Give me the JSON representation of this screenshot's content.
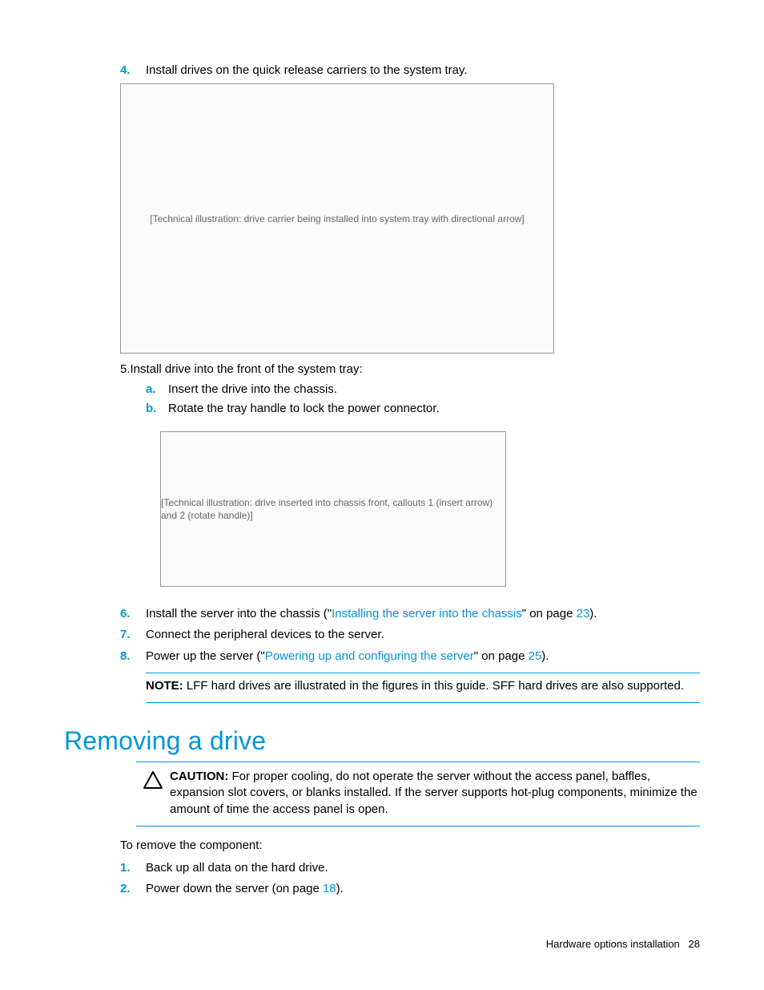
{
  "steps": {
    "s4": {
      "num": "4.",
      "text": "Install drives on the quick release carriers to the system tray."
    },
    "s5": {
      "num": "5.",
      "text": "Install drive into the front of the system tray:",
      "sub": {
        "a": {
          "num": "a.",
          "text": "Insert the drive into the chassis."
        },
        "b": {
          "num": "b.",
          "text": "Rotate the tray handle to lock the power connector."
        }
      }
    },
    "s6": {
      "num": "6.",
      "pre": "Install the server into the chassis (\"",
      "link": "Installing the server into the chassis",
      "mid": "\" on page ",
      "page": "23",
      "post": ")."
    },
    "s7": {
      "num": "7.",
      "text": "Connect the peripheral devices to the server."
    },
    "s8": {
      "num": "8.",
      "pre": "Power up the server (\"",
      "link": "Powering up and configuring the server",
      "mid": "\" on page ",
      "page": "25",
      "post": ")."
    }
  },
  "note": {
    "label": "NOTE:",
    "text": "  LFF hard drives are illustrated in the figures in this guide. SFF hard drives are also supported."
  },
  "heading": "Removing a drive",
  "caution": {
    "label": "CAUTION:",
    "text": "   For proper cooling, do not operate the server without the access panel, baffles, expansion slot covers, or blanks installed. If the server supports hot-plug components, minimize the amount of time the access panel is open."
  },
  "intro": "To remove the component:",
  "remove": {
    "r1": {
      "num": "1.",
      "text": "Back up all data on the hard drive."
    },
    "r2": {
      "num": "2.",
      "pre": "Power down the server (on page ",
      "page": "18",
      "post": ")."
    }
  },
  "figures": {
    "f1": "[Technical illustration: drive carrier being installed into system tray with directional arrow]",
    "f2": "[Technical illustration: drive inserted into chassis front, callouts 1 (insert arrow) and 2 (rotate handle)]"
  },
  "footer": {
    "section": "Hardware options installation",
    "page": "28"
  }
}
